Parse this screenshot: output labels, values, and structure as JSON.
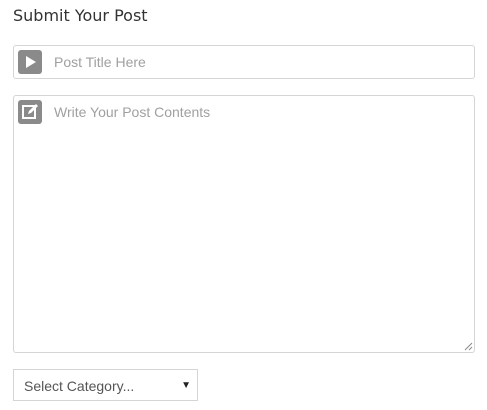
{
  "form": {
    "title": "Submit Your Post"
  },
  "post_title": {
    "placeholder": "Post Title Here",
    "value": "",
    "icon": "play-icon"
  },
  "post_content": {
    "placeholder": "Write Your Post Contents",
    "value": "",
    "icon": "edit-icon"
  },
  "category": {
    "selected": "Select Category...",
    "arrow": "▼"
  },
  "colors": {
    "icon_bg": "#8a8a8a",
    "border": "#d5d5d5",
    "placeholder": "#a0a0a0",
    "title_text": "#333333"
  }
}
